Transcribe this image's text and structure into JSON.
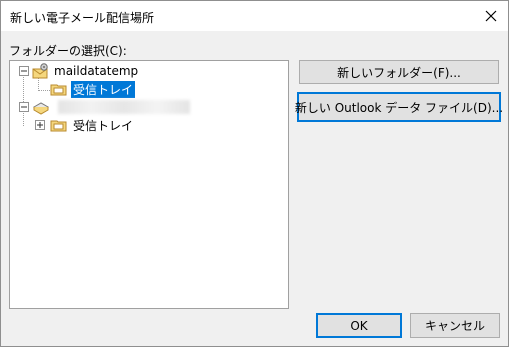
{
  "window": {
    "title": "新しい電子メール配信場所",
    "close_icon": "close-icon"
  },
  "folder_select_label": "フォルダーの選択(C):",
  "tree": {
    "account": "maildatatemp",
    "account_inbox": "受信トレイ",
    "second_inbox": "受信トレイ"
  },
  "buttons": {
    "new_folder": "新しいフォルダー(F)...",
    "new_outlook_data_file": "新しい Outlook データ ファイル(D)...",
    "ok": "OK",
    "cancel": "キャンセル"
  },
  "colors": {
    "selection": "#0078d7",
    "folder": "#f5d77e",
    "focus_border": "#0078d7"
  }
}
